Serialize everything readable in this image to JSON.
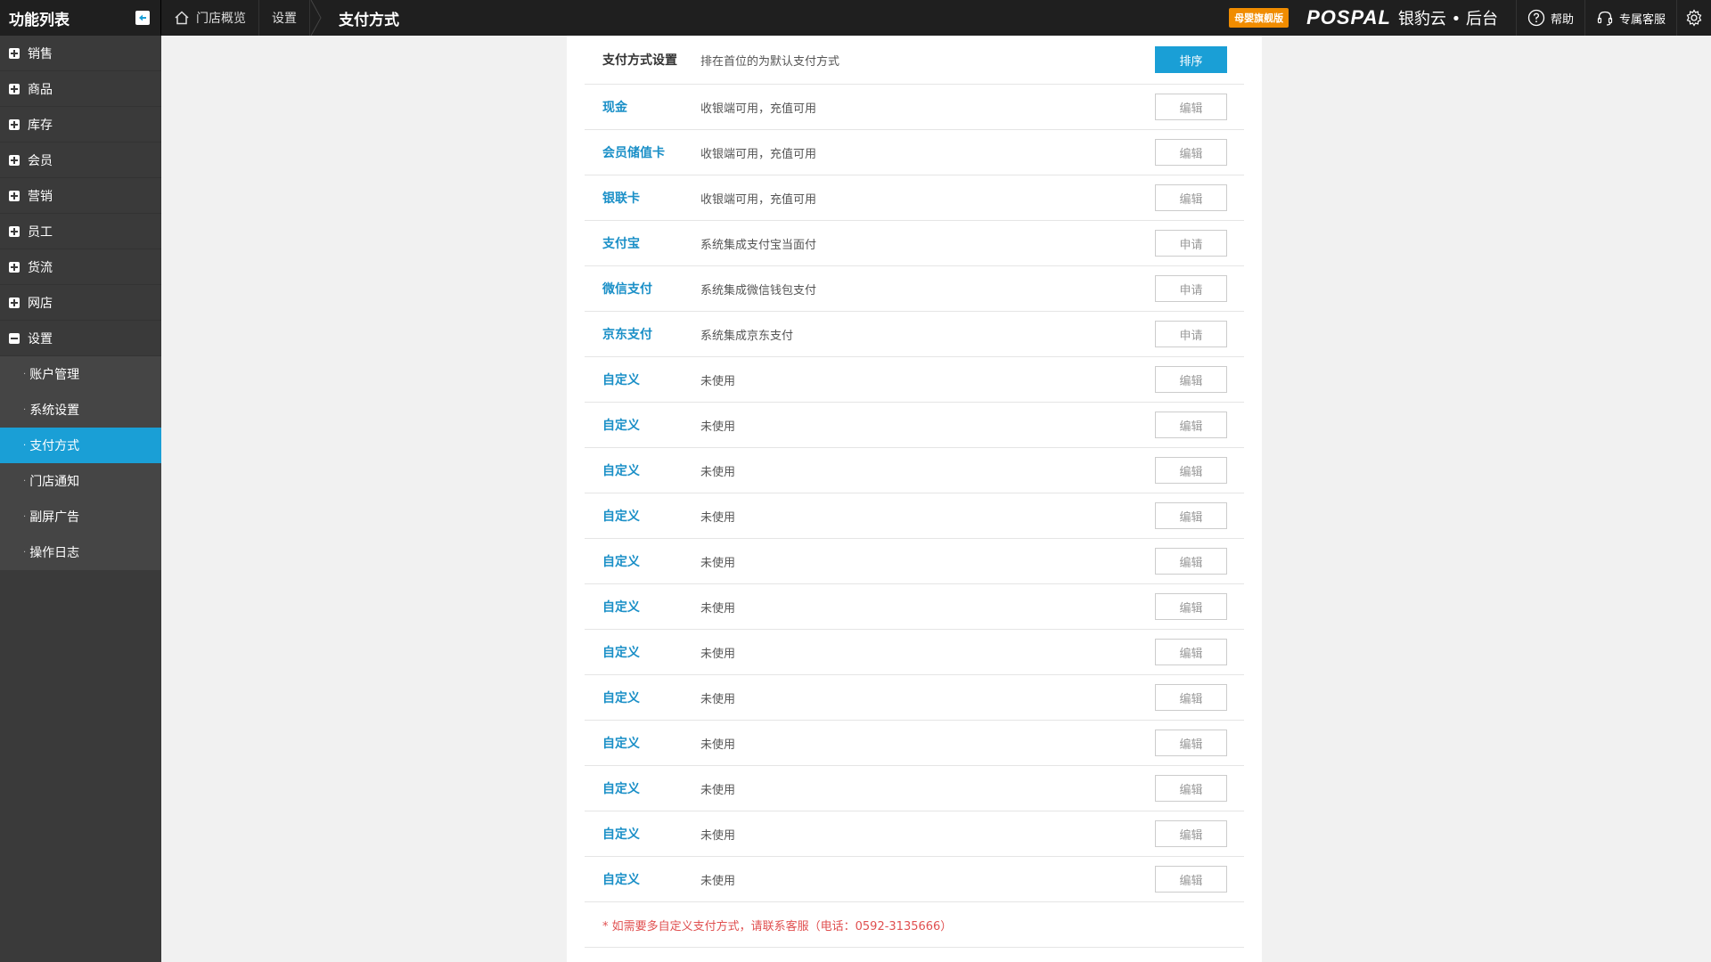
{
  "topbar": {
    "menu_title": "功能列表",
    "breadcrumb": [
      "门店概览",
      "设置"
    ],
    "current_page": "支付方式",
    "badge": "母婴旗舰版",
    "brand_logo": "POSPAL",
    "brand_name": "银豹云 • 后台",
    "help_label": "帮助",
    "service_label": "专属客服"
  },
  "sidebar": {
    "items": [
      {
        "label": "销售"
      },
      {
        "label": "商品"
      },
      {
        "label": "库存"
      },
      {
        "label": "会员"
      },
      {
        "label": "营销"
      },
      {
        "label": "员工"
      },
      {
        "label": "货流"
      },
      {
        "label": "网店"
      },
      {
        "label": "设置"
      }
    ],
    "sub_items": [
      {
        "label": "账户管理"
      },
      {
        "label": "系统设置"
      },
      {
        "label": "支付方式"
      },
      {
        "label": "门店通知"
      },
      {
        "label": "副屏广告"
      },
      {
        "label": "操作日志"
      }
    ]
  },
  "main": {
    "header": {
      "name": "支付方式设置",
      "desc": "排在首位的为默认支付方式",
      "action": "排序"
    },
    "rows": [
      {
        "name": "现金",
        "desc": "收银端可用，充值可用",
        "action": "编辑"
      },
      {
        "name": "会员储值卡",
        "desc": "收银端可用，充值可用",
        "action": "编辑"
      },
      {
        "name": "银联卡",
        "desc": "收银端可用，充值可用",
        "action": "编辑"
      },
      {
        "name": "支付宝",
        "desc": "系统集成支付宝当面付",
        "action": "申请"
      },
      {
        "name": "微信支付",
        "desc": "系统集成微信钱包支付",
        "action": "申请"
      },
      {
        "name": "京东支付",
        "desc": "系统集成京东支付",
        "action": "申请"
      },
      {
        "name": "自定义",
        "desc": "未使用",
        "action": "编辑"
      },
      {
        "name": "自定义",
        "desc": "未使用",
        "action": "编辑"
      },
      {
        "name": "自定义",
        "desc": "未使用",
        "action": "编辑"
      },
      {
        "name": "自定义",
        "desc": "未使用",
        "action": "编辑"
      },
      {
        "name": "自定义",
        "desc": "未使用",
        "action": "编辑"
      },
      {
        "name": "自定义",
        "desc": "未使用",
        "action": "编辑"
      },
      {
        "name": "自定义",
        "desc": "未使用",
        "action": "编辑"
      },
      {
        "name": "自定义",
        "desc": "未使用",
        "action": "编辑"
      },
      {
        "name": "自定义",
        "desc": "未使用",
        "action": "编辑"
      },
      {
        "name": "自定义",
        "desc": "未使用",
        "action": "编辑"
      },
      {
        "name": "自定义",
        "desc": "未使用",
        "action": "编辑"
      },
      {
        "name": "自定义",
        "desc": "未使用",
        "action": "编辑"
      }
    ],
    "note": "* 如需要多自定义支付方式，请联系客服（电话：0592-3135666）"
  },
  "colors": {
    "accent": "#1a9fd6",
    "topbar_bg": "#1f1f1f",
    "sidebar_bg": "#3a3a3a",
    "link": "#1a8fc7",
    "note": "#e05050",
    "badge": "#f08c00"
  }
}
